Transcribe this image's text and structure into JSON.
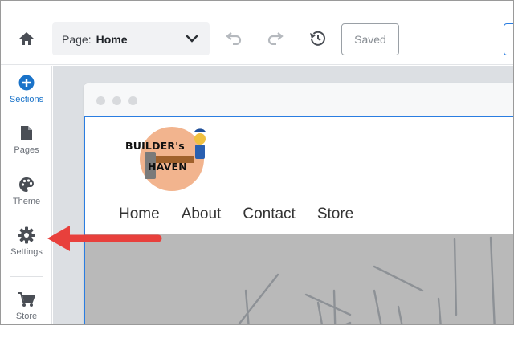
{
  "topbar": {
    "home_icon": "home-icon",
    "page_select": {
      "label": "Page:",
      "value": "Home"
    },
    "undo_icon": "undo-icon",
    "redo_icon": "redo-icon",
    "history_icon": "history-icon",
    "saved_label": "Saved"
  },
  "sidebar": {
    "items": [
      {
        "label": "Sections",
        "icon": "plus-circle-icon"
      },
      {
        "label": "Pages",
        "icon": "page-icon"
      },
      {
        "label": "Theme",
        "icon": "palette-icon"
      },
      {
        "label": "Settings",
        "icon": "gear-icon"
      },
      {
        "label": "Store",
        "icon": "cart-icon"
      }
    ]
  },
  "site": {
    "logo": {
      "line1": "BUILDER's",
      "line2": "HAVEN"
    },
    "nav": [
      "Home",
      "About",
      "Contact",
      "Store"
    ]
  },
  "colors": {
    "accent": "#1a73c9",
    "arrow": "#e8403c",
    "logo_circle": "#f2b48e"
  }
}
